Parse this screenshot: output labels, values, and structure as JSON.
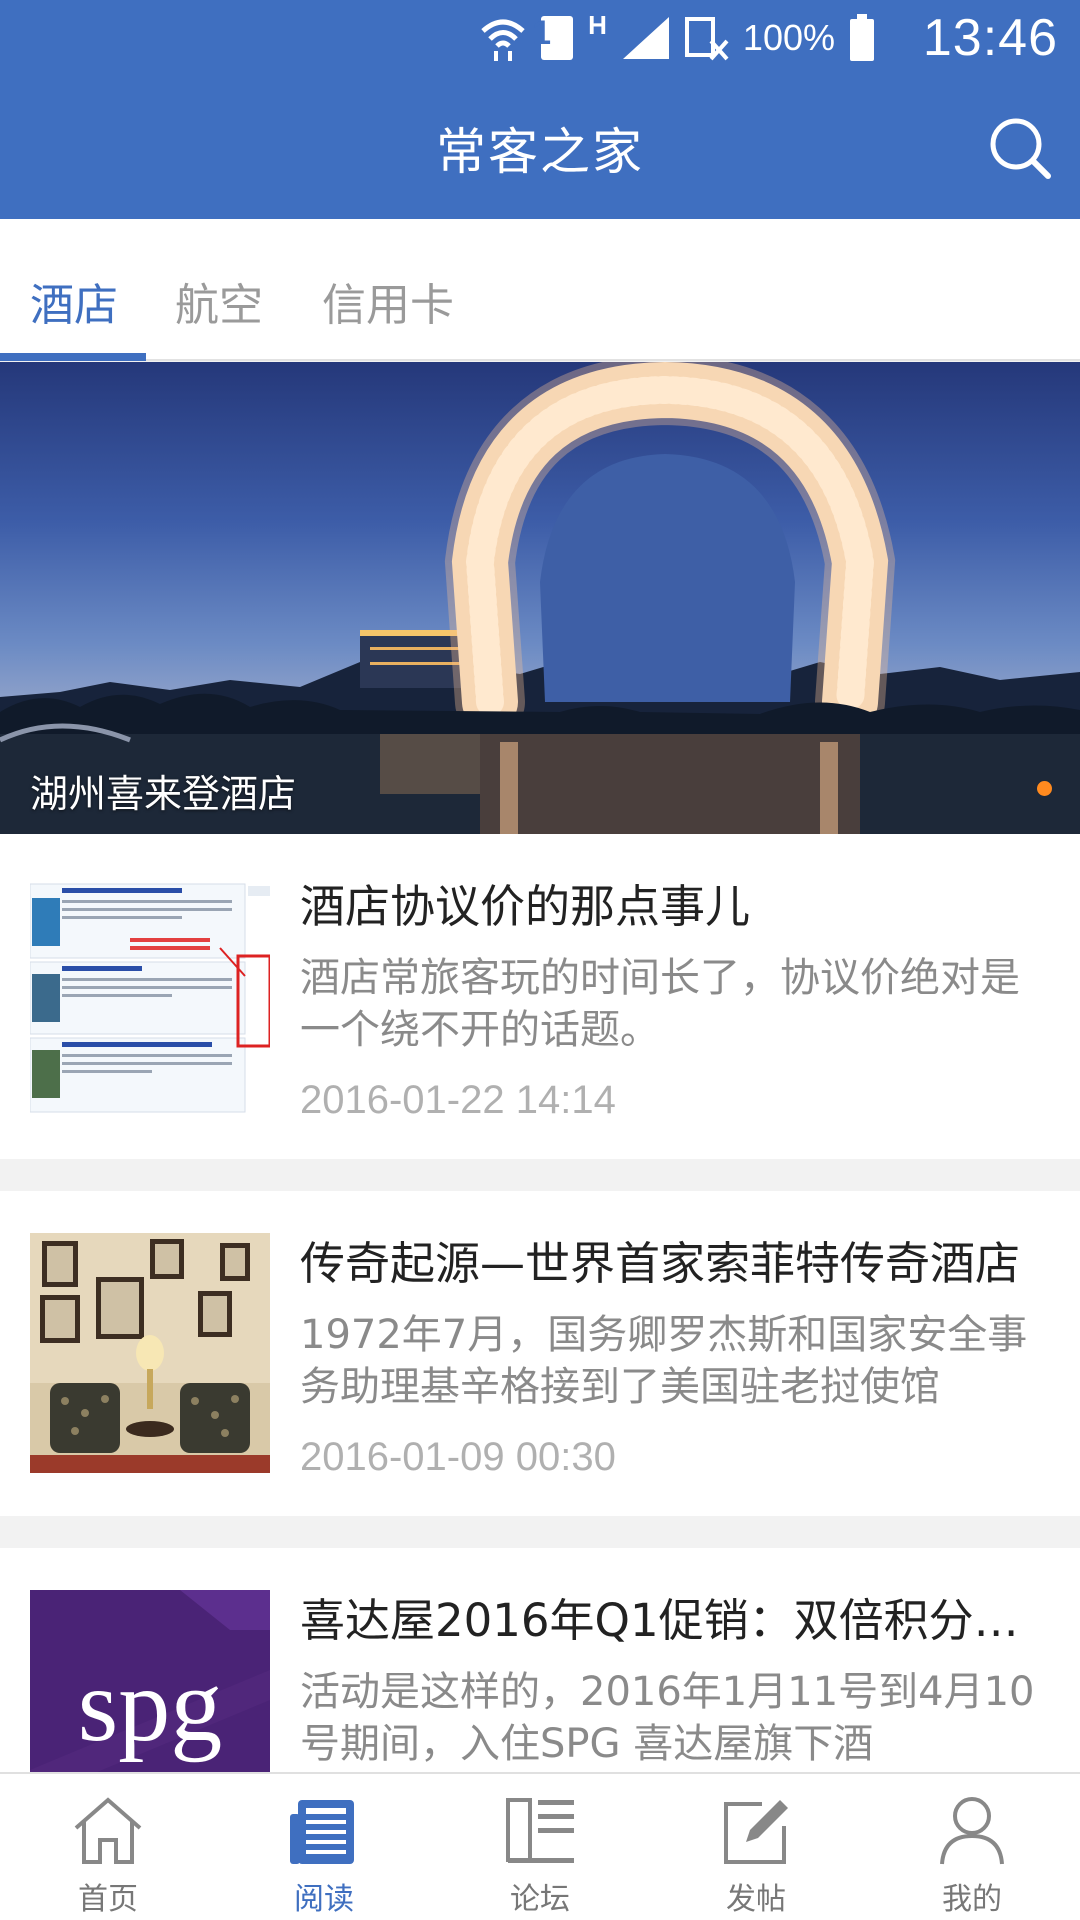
{
  "status": {
    "battery": "100%",
    "time": "13:46",
    "sim": "1",
    "network": "H"
  },
  "header": {
    "title": "常客之家",
    "search_icon": "search-icon"
  },
  "tabs": [
    {
      "label": "酒店",
      "active": true
    },
    {
      "label": "航空",
      "active": false
    },
    {
      "label": "信用卡",
      "active": false
    }
  ],
  "banner": {
    "caption": "湖州喜来登酒店",
    "slides_indicator": "orange-dot",
    "indicator_color": "#ff8a1f"
  },
  "articles": [
    {
      "title": "酒店协议价的那点事儿",
      "summary": "酒店常旅客玩的时间长了，协议价绝对是一个绕不开的话题。",
      "date": "2016-01-22 14:14"
    },
    {
      "title": "传奇起源—世界首家索菲特传奇酒店",
      "summary": "1972年7月，国务卿罗杰斯和国家安全事务助理基辛格接到了美国驻老挝使馆",
      "date": "2016-01-09 00:30"
    },
    {
      "title": "喜达屋2016年Q1促销：双倍积分…",
      "summary": "活动是这样的，2016年1月11号到4月10号期间，入住SPG 喜达屋旗下酒",
      "date": "",
      "thumb_logo": "spg"
    }
  ],
  "bottom_nav": [
    {
      "label": "首页",
      "icon": "home-icon",
      "active": false
    },
    {
      "label": "阅读",
      "icon": "reading-icon",
      "active": true
    },
    {
      "label": "论坛",
      "icon": "forum-icon",
      "active": false
    },
    {
      "label": "发帖",
      "icon": "compose-icon",
      "active": false
    },
    {
      "label": "我的",
      "icon": "profile-icon",
      "active": false
    }
  ],
  "colors": {
    "primary": "#3f6fc0",
    "accent": "#ff8a1f",
    "background": "#f2f2f2"
  }
}
